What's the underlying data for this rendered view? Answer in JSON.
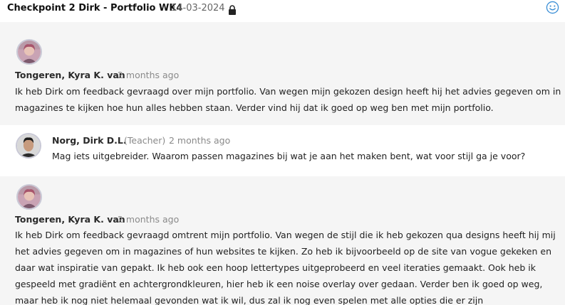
{
  "header": {
    "title": "Checkpoint 2  Dirk - Portfolio WK4",
    "date": "14-03-2024",
    "lock_icon": "lock-icon",
    "reaction_icon": "smiley-icon"
  },
  "comments": [
    {
      "author": "Tongeren, Kyra K. van",
      "role": "",
      "time": "2 months ago",
      "text": "Ik heb Dirk om feedback gevraagd over mijn portfolio. Van wegen mijn gekozen design heeft hij het advies gegeven om in magazines te kijken hoe hun alles hebben staan. Verder vind hij dat ik goed op weg ben met mijn portfolio."
    },
    {
      "author": "Norg, Dirk D.L.",
      "role": "(Teacher)",
      "time": "2 months ago",
      "text": "Mag iets uitgebreider. Waarom passen magazines bij wat je aan het maken bent, wat voor stijl ga je voor?"
    },
    {
      "author": "Tongeren, Kyra K. van",
      "role": "",
      "time": "2 months ago",
      "text": "Ik heb Dirk om feedback gevraagd omtrent mijn portfolio. Van wegen de stijl die ik heb gekozen qua designs heeft hij mij het advies gegeven om in magazines of hun websites te kijken. Zo heb ik bijvoorbeeld op de site van vogue gekeken en daar wat inspiratie van gepakt. Ik heb ook een hoop lettertypes uitgeprobeerd en veel iteraties gemaakt. Ook heb ik gespeeld met gradiënt en achtergrondkleuren, hier heb ik een noise overlay over gedaan. Verder ben ik goed op weg, maar heb ik nog niet helemaal gevonden wat ik wil, dus zal ik nog even spelen met alle opties die er zijn"
    }
  ],
  "colors": {
    "gray_bg": "#f5f5f5",
    "smiley": "#3b8fd6"
  }
}
